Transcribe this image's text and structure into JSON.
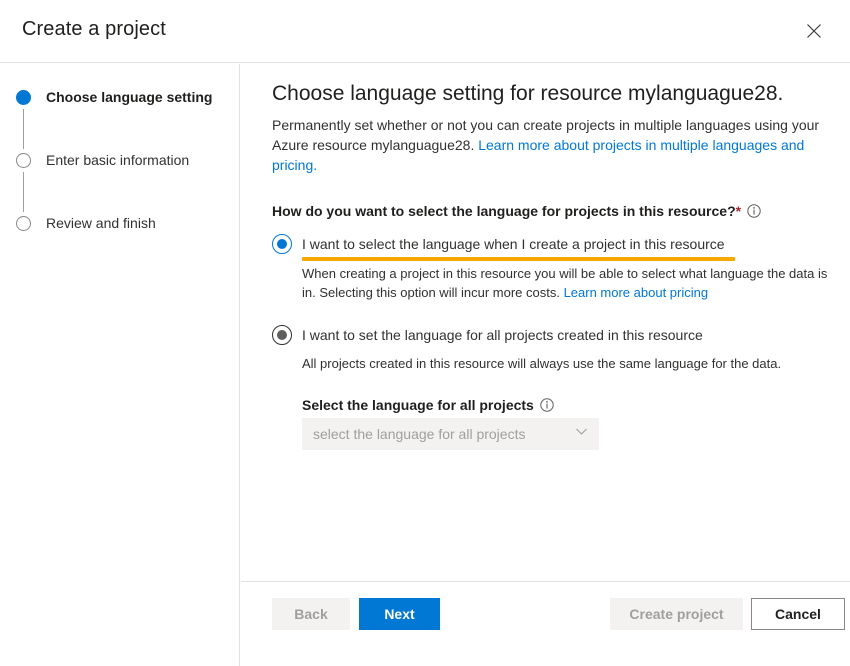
{
  "dialog": {
    "title": "Create a project",
    "close_label": "Close",
    "close_icon": "close-icon"
  },
  "steps": [
    {
      "label": "Choose language setting",
      "state": "active"
    },
    {
      "label": "Enter basic information",
      "state": "inactive"
    },
    {
      "label": "Review and finish",
      "state": "inactive"
    }
  ],
  "main": {
    "heading": "Choose language setting for resource mylanguague28.",
    "description_part1": "Permanently set whether or not you can create projects in multiple languages using your Azure resource mylanguague28. ",
    "description_link": "Learn more about projects in multiple languages and pricing.",
    "question": "How do you want to select the language for projects in this resource?",
    "question_required_marker": "*",
    "question_info_icon": "info-icon",
    "options": [
      {
        "label": "I want to select the language when I create a project in this resource",
        "state": "checked",
        "highlighted": true,
        "description_part1": "When creating a project in this resource you will be able to select what language the data is in. Selecting this option will incur more costs. ",
        "description_link": "Learn more about pricing"
      },
      {
        "label": "I want to set the language for all projects created in this resource",
        "state": "hovered",
        "highlighted": false,
        "description_part1": "All projects created in this resource will always use the same language for the data.",
        "description_link": ""
      }
    ],
    "language_field": {
      "label": "Select the language for all projects",
      "info_icon": "info-icon",
      "placeholder": "select the language for all projects",
      "value": "",
      "chevron_icon": "chevron-down-icon"
    }
  },
  "footer": {
    "back_label": "Back",
    "next_label": "Next",
    "create_label": "Create project",
    "cancel_label": "Cancel"
  },
  "colors": {
    "accent_blue": "#0078d4",
    "highlight_orange": "#f5a800",
    "required_red": "#a4262c",
    "disabled_bg": "#f3f2f1",
    "disabled_text": "#a19f9d",
    "border_gray": "#e1e1e1"
  }
}
